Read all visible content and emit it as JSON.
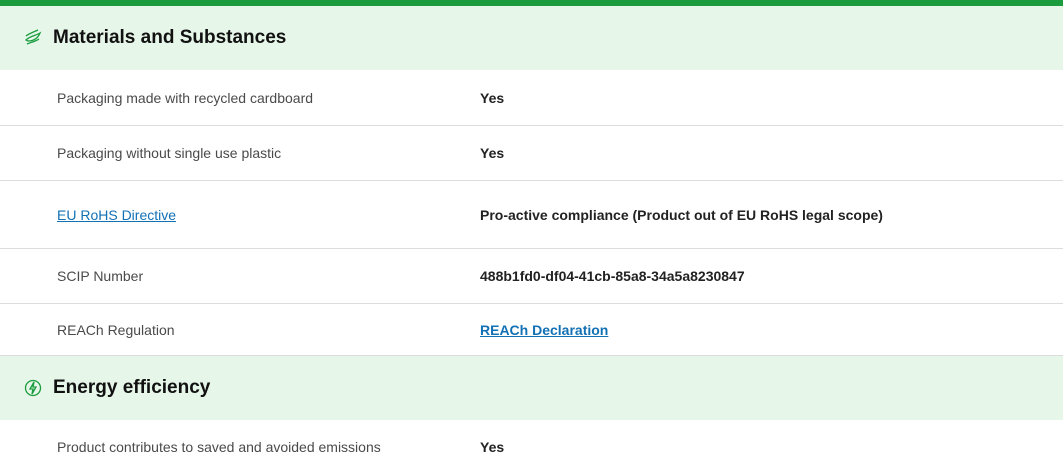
{
  "colors": {
    "accent": "#1a9c3e",
    "section_bg": "#e6f6e8",
    "link": "#1270b5"
  },
  "sections": [
    {
      "title": "Materials and Substances",
      "icon": "leaf-layers-icon",
      "rows": [
        {
          "label": "Packaging made with recycled cardboard",
          "value": "Yes"
        },
        {
          "label": "Packaging without single use plastic",
          "value": "Yes"
        },
        {
          "label": "EU RoHS Directive",
          "value": "Pro-active compliance (Product out of EU RoHS legal scope)"
        },
        {
          "label": "SCIP Number",
          "value": "488b1fd0-df04-41cb-85a8-34a5a8230847"
        },
        {
          "label": "REACh Regulation",
          "value": "REACh Declaration"
        }
      ]
    },
    {
      "title": "Energy efficiency",
      "icon": "energy-leaf-icon",
      "rows": [
        {
          "label": "Product contributes to saved and avoided emissions",
          "value": "Yes"
        }
      ]
    }
  ]
}
